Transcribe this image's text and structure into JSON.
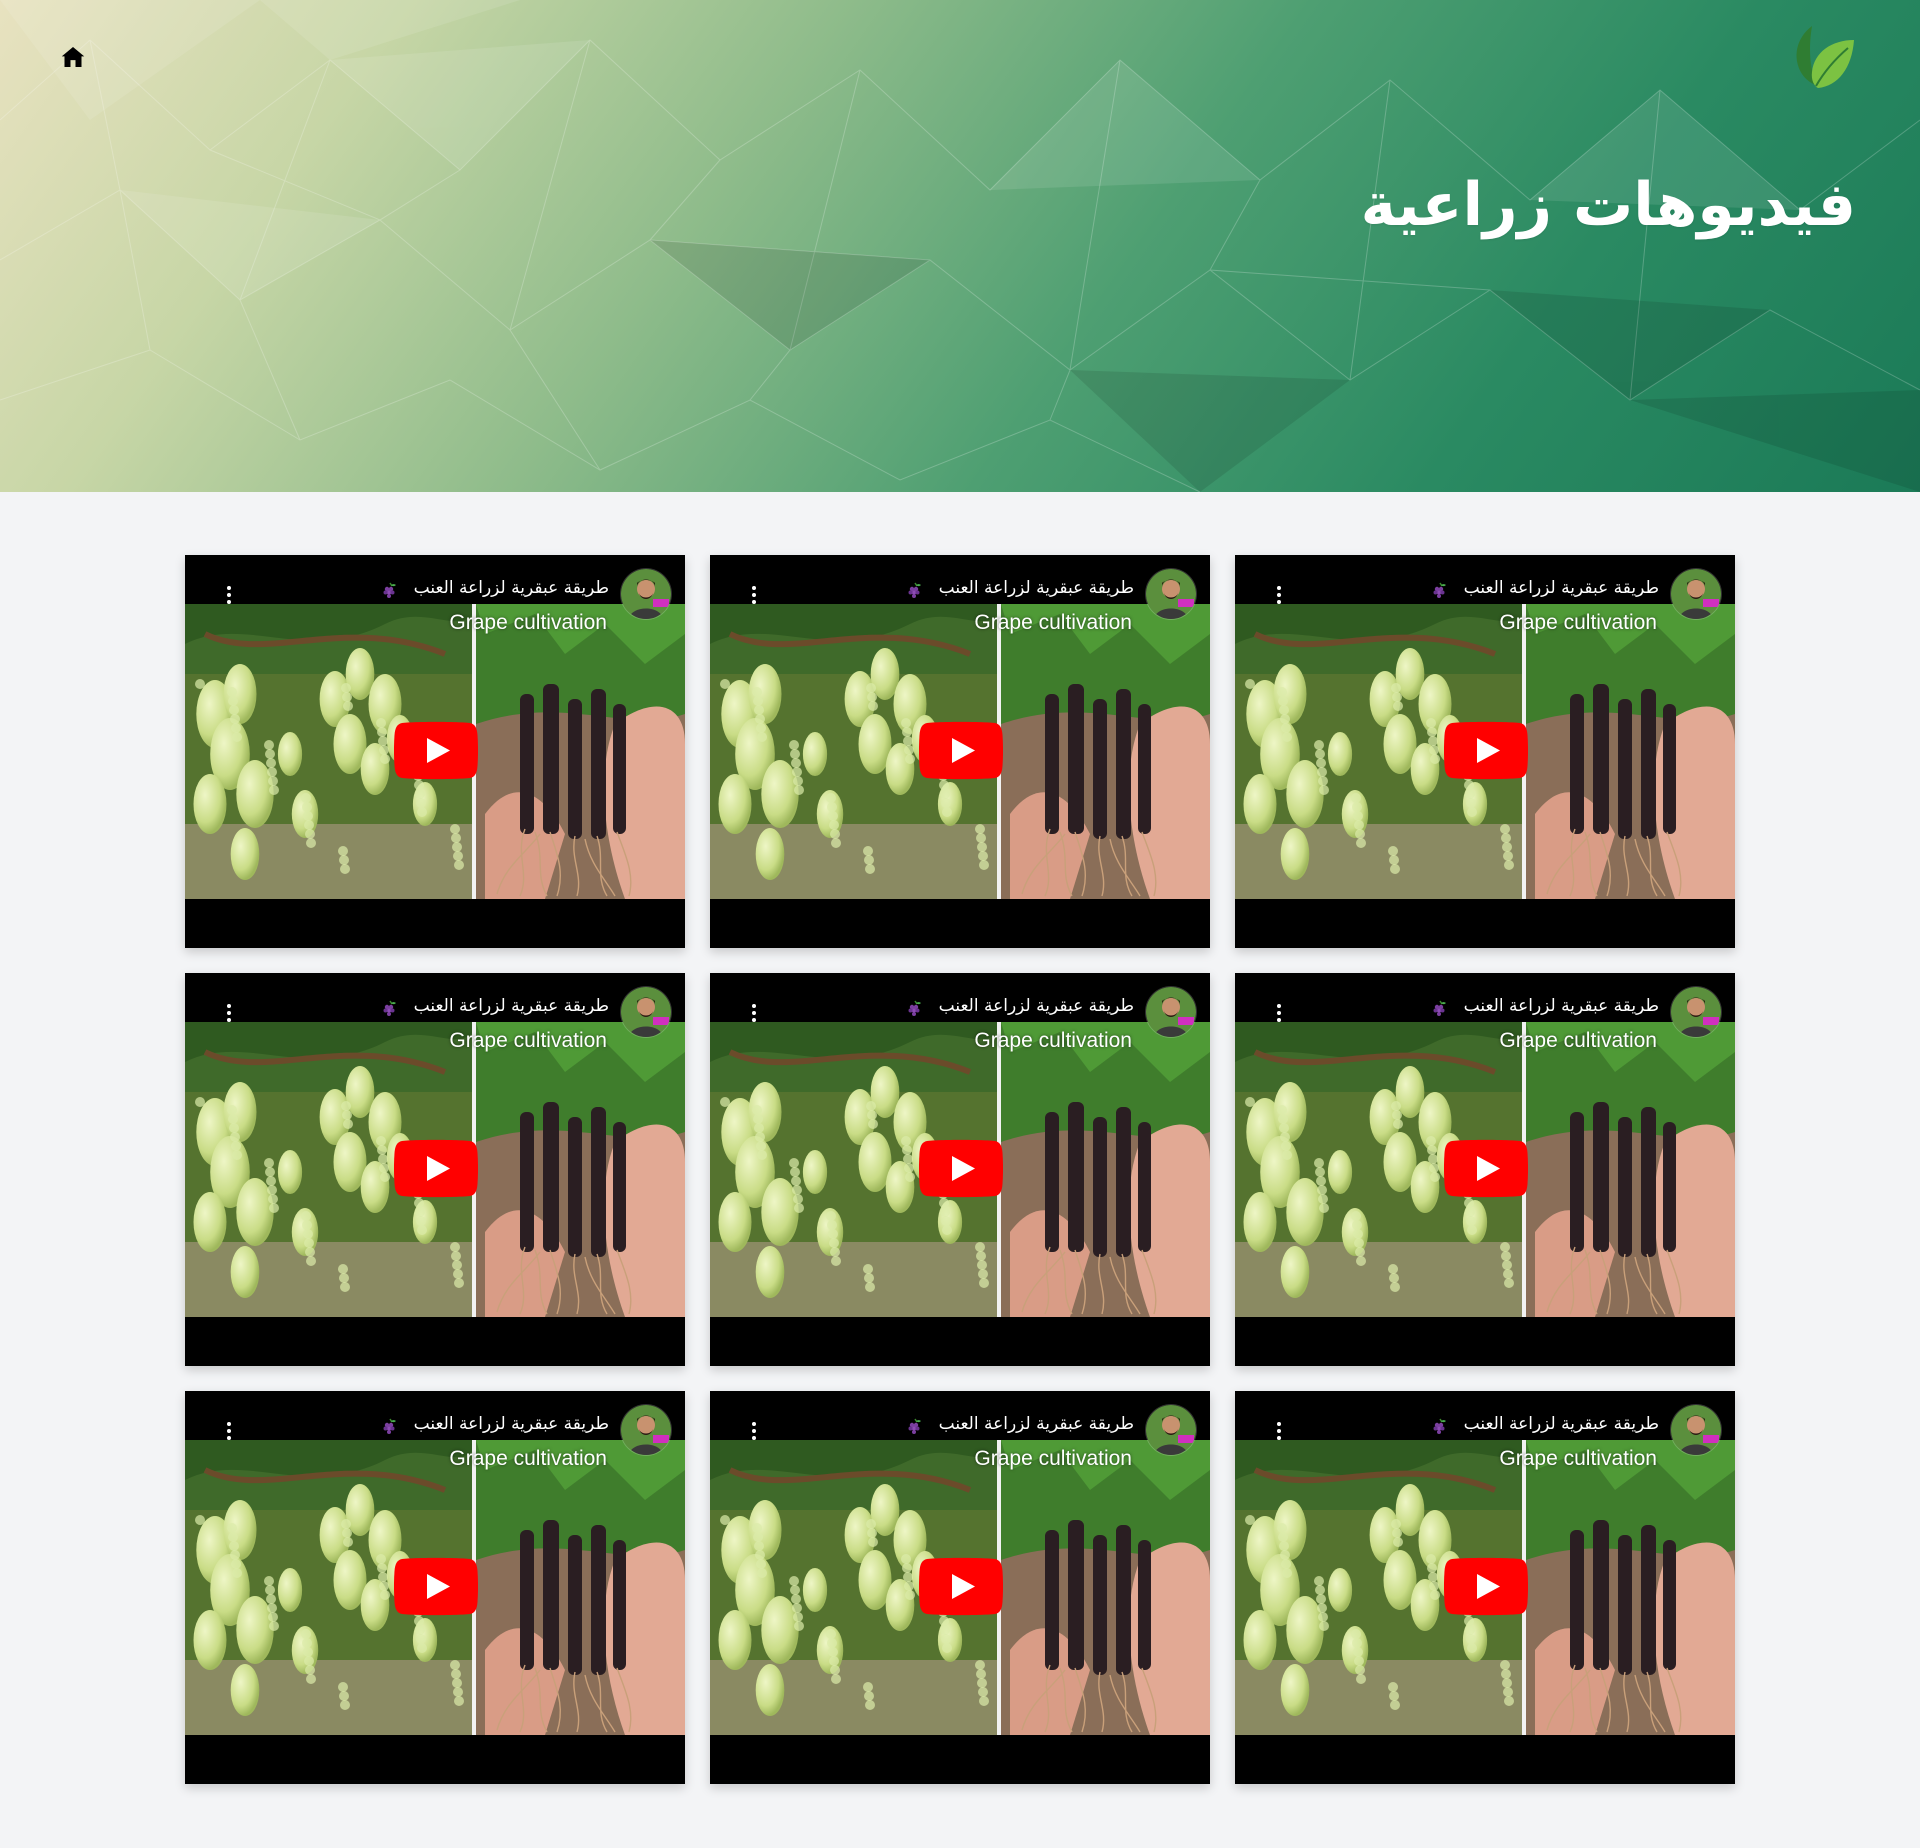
{
  "page": {
    "title": "فيديوهات زراعية",
    "home_icon": "home-icon",
    "logo_icon": "leaf-logo-icon"
  },
  "colors": {
    "hero_start": "#e8e2c0",
    "hero_end": "#1b7a57",
    "page_bg": "#f3f4f6",
    "play_button": "#ff0000",
    "leaf_dark": "#2f7d32",
    "leaf_light": "#7cc242"
  },
  "videos": [
    {
      "title": "طريقة عبقرية لزراعة العنب",
      "caption": "Grape cultivation",
      "menu_icon": "more-vert-icon",
      "play_icon": "youtube-play-icon"
    },
    {
      "title": "طريقة عبقرية لزراعة العنب",
      "caption": "Grape cultivation",
      "menu_icon": "more-vert-icon",
      "play_icon": "youtube-play-icon"
    },
    {
      "title": "طريقة عبقرية لزراعة العنب",
      "caption": "Grape cultivation",
      "menu_icon": "more-vert-icon",
      "play_icon": "youtube-play-icon"
    },
    {
      "title": "طريقة عبقرية لزراعة العنب",
      "caption": "Grape cultivation",
      "menu_icon": "more-vert-icon",
      "play_icon": "youtube-play-icon"
    },
    {
      "title": "طريقة عبقرية لزراعة العنب",
      "caption": "Grape cultivation",
      "menu_icon": "more-vert-icon",
      "play_icon": "youtube-play-icon"
    },
    {
      "title": "طريقة عبقرية لزراعة العنب",
      "caption": "Grape cultivation",
      "menu_icon": "more-vert-icon",
      "play_icon": "youtube-play-icon"
    },
    {
      "title": "طريقة عبقرية لزراعة العنب",
      "caption": "Grape cultivation",
      "menu_icon": "more-vert-icon",
      "play_icon": "youtube-play-icon"
    },
    {
      "title": "طريقة عبقرية لزراعة العنب",
      "caption": "Grape cultivation",
      "menu_icon": "more-vert-icon",
      "play_icon": "youtube-play-icon"
    },
    {
      "title": "طريقة عبقرية لزراعة العنب",
      "caption": "Grape cultivation",
      "menu_icon": "more-vert-icon",
      "play_icon": "youtube-play-icon"
    }
  ]
}
